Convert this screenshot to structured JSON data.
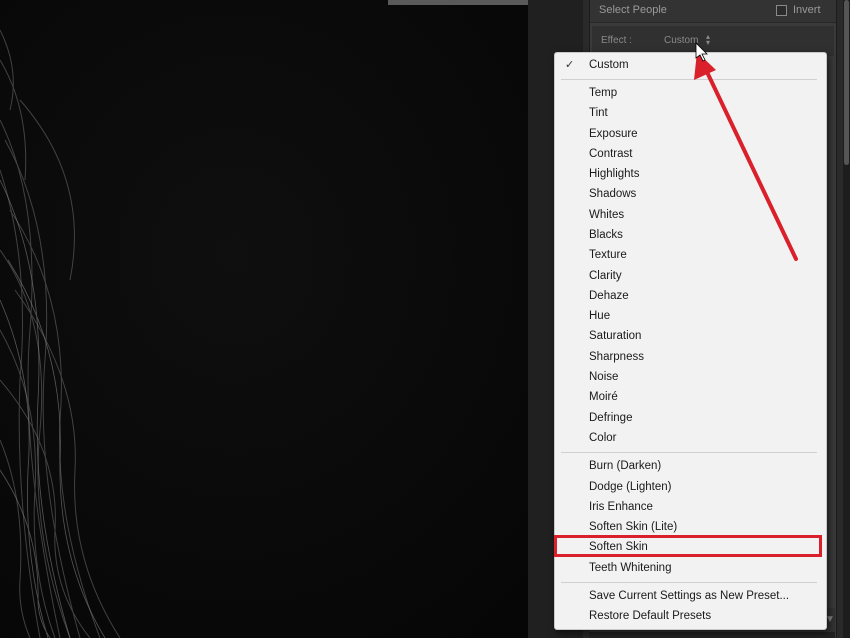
{
  "panel": {
    "select_people_label": "Select People",
    "invert_label": "Invert",
    "effect_label": "Effect :",
    "effect_value": "Custom"
  },
  "menu": {
    "checked_item": "Custom",
    "group_1": [
      "Temp",
      "Tint",
      "Exposure",
      "Contrast",
      "Highlights",
      "Shadows",
      "Whites",
      "Blacks",
      "Texture",
      "Clarity",
      "Dehaze",
      "Hue",
      "Saturation",
      "Sharpness",
      "Noise",
      "Moiré",
      "Defringe",
      "Color"
    ],
    "group_2": [
      "Burn (Darken)",
      "Dodge (Lighten)",
      "Iris Enhance",
      "Soften Skin (Lite)",
      "Soften Skin",
      "Teeth Whitening"
    ],
    "group_3": [
      "Save Current Settings as New Preset...",
      "Restore Default Presets"
    ]
  },
  "annotation": {
    "highlighted_item": "Soften Skin",
    "highlight_color": "#d9202b",
    "arrow_color": "#d9202b"
  }
}
